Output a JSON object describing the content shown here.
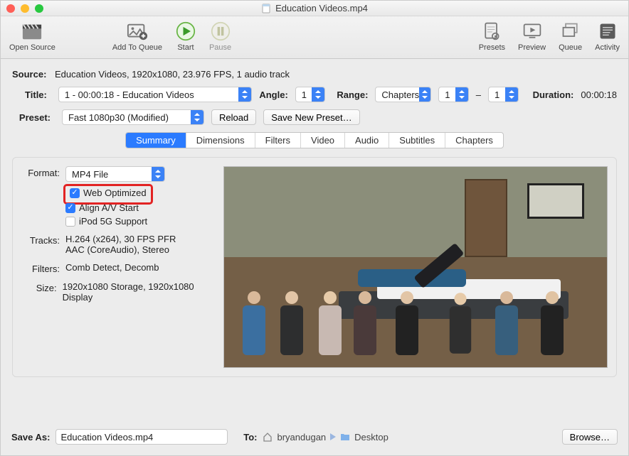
{
  "window": {
    "title": "Education Videos.mp4"
  },
  "toolbar": {
    "open_source": "Open Source",
    "add_to_queue": "Add To Queue",
    "start": "Start",
    "pause": "Pause",
    "presets": "Presets",
    "preview": "Preview",
    "queue": "Queue",
    "activity": "Activity"
  },
  "source": {
    "label": "Source:",
    "value": "Education Videos, 1920x1080, 23.976 FPS, 1 audio track"
  },
  "title_row": {
    "label": "Title:",
    "value": "1 - 00:00:18 - Education Videos",
    "angle_label": "Angle:",
    "angle_value": "1",
    "range_label": "Range:",
    "range_type": "Chapters",
    "range_from": "1",
    "range_dash": "–",
    "range_to": "1",
    "duration_label": "Duration:",
    "duration_value": "00:00:18"
  },
  "preset_row": {
    "label": "Preset:",
    "value": "Fast 1080p30 (Modified)",
    "reload": "Reload",
    "save_new": "Save New Preset…"
  },
  "tabs": [
    "Summary",
    "Dimensions",
    "Filters",
    "Video",
    "Audio",
    "Subtitles",
    "Chapters"
  ],
  "active_tab": 0,
  "summary": {
    "format_label": "Format:",
    "format_value": "MP4 File",
    "web_optimized": "Web Optimized",
    "align_av": "Align A/V Start",
    "ipod": "iPod 5G Support",
    "tracks_label": "Tracks:",
    "tracks_line1": "H.264 (x264), 30 FPS PFR",
    "tracks_line2": "AAC (CoreAudio), Stereo",
    "filters_label": "Filters:",
    "filters_value": "Comb Detect, Decomb",
    "size_label": "Size:",
    "size_value": "1920x1080 Storage, 1920x1080 Display"
  },
  "saveas": {
    "label": "Save As:",
    "value": "Education Videos.mp4",
    "to_label": "To:",
    "path_user": "bryandugan",
    "path_folder": "Desktop",
    "browse": "Browse…"
  }
}
